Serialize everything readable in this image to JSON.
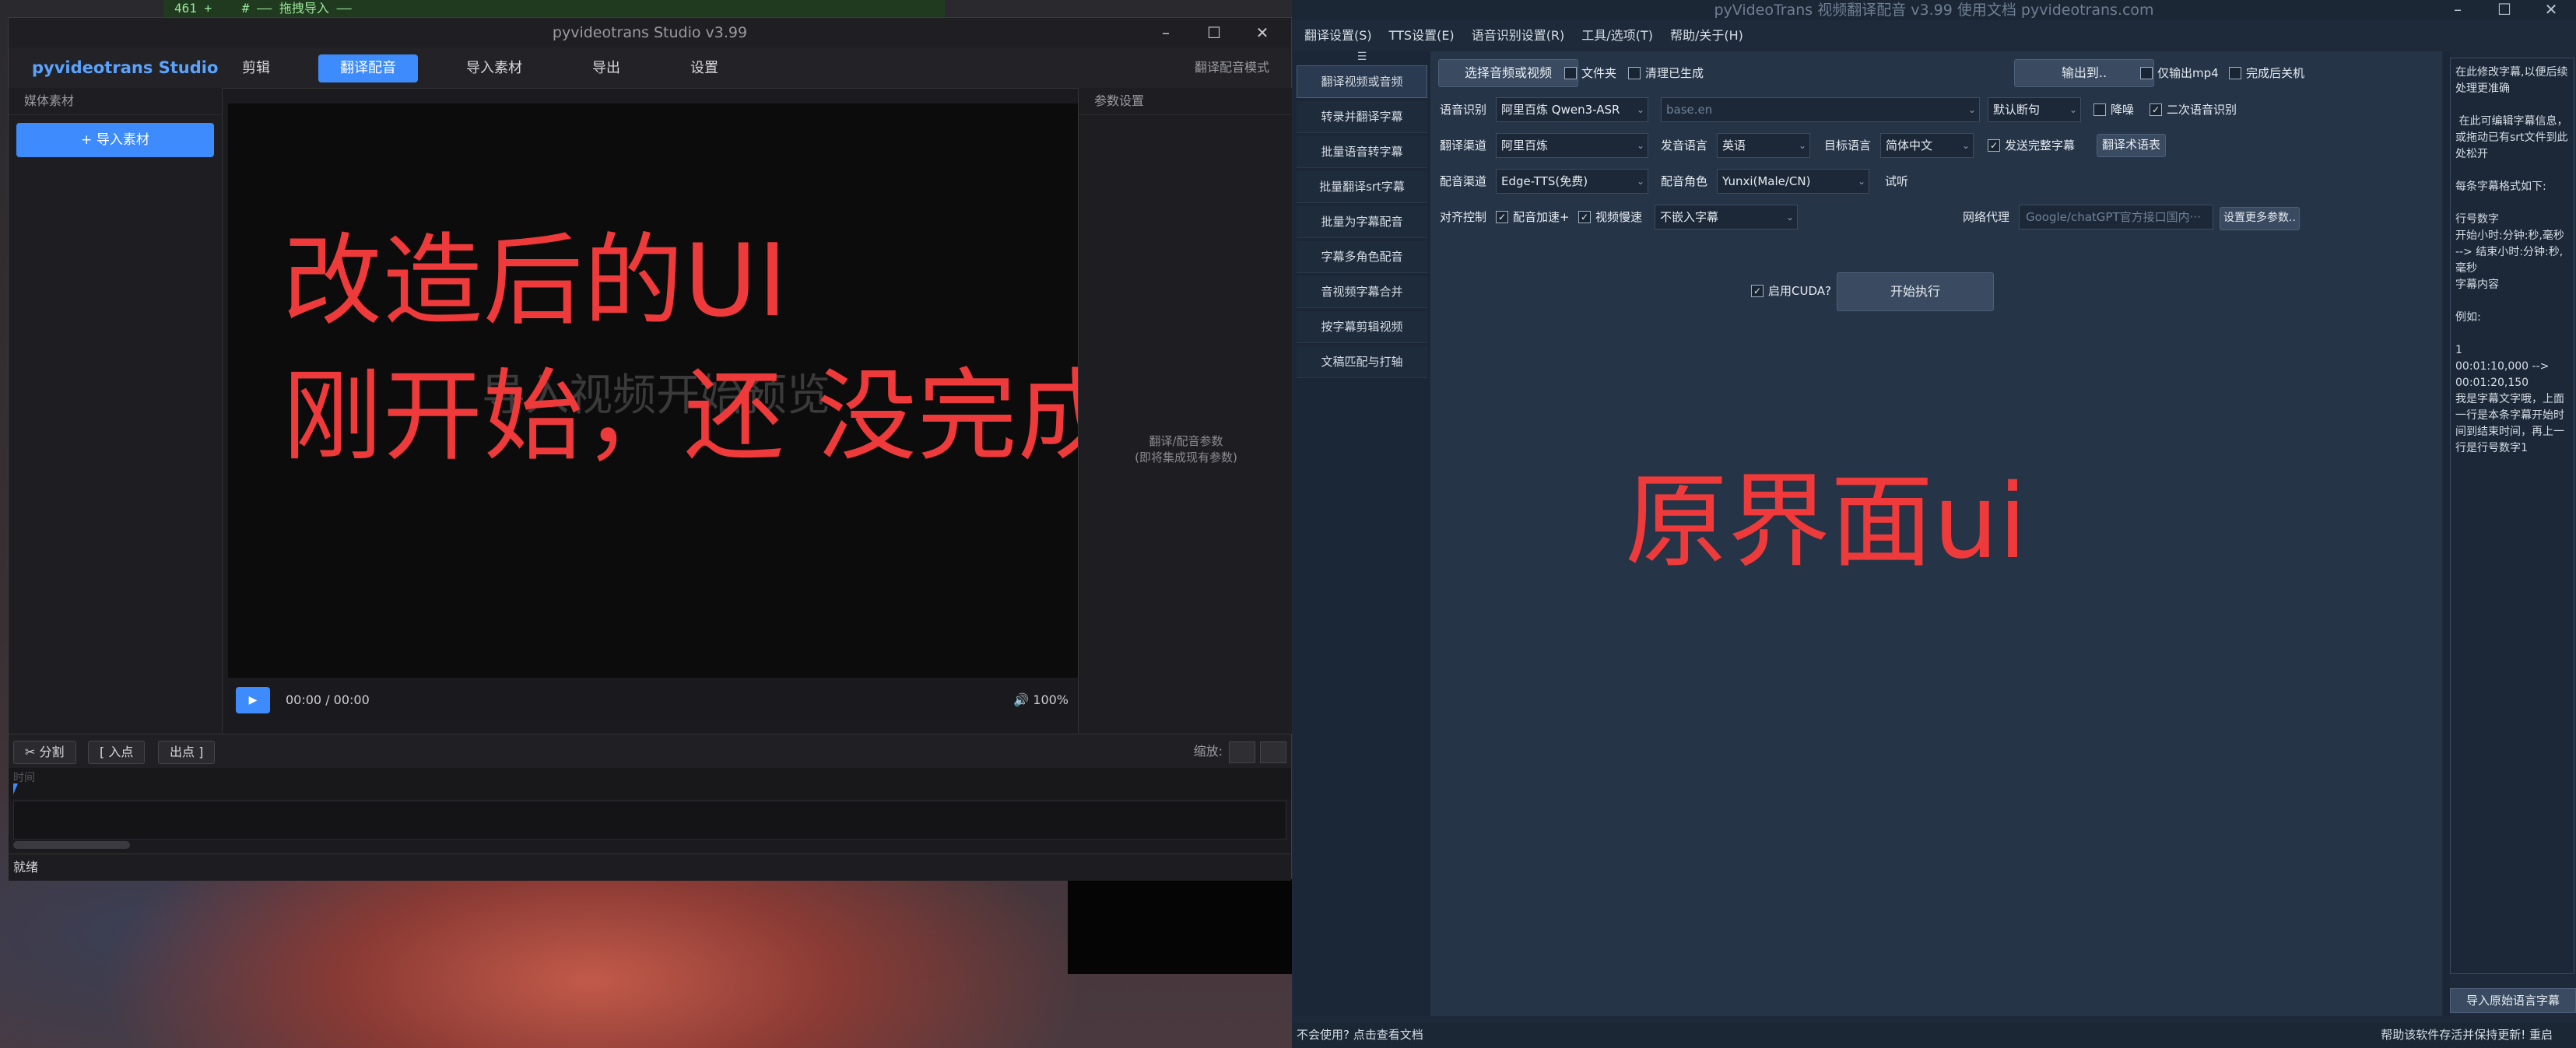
{
  "background": {
    "editor_line": "461 +    # —— 拖拽导入 ——"
  },
  "left_window": {
    "title": "pyvideotrans Studio v3.99",
    "window_controls": [
      "–",
      "☐",
      "✕"
    ],
    "brand": "pyvideotrans Studio",
    "tabs": [
      {
        "label": "剪辑",
        "active": false
      },
      {
        "label": "翻译配音",
        "active": true
      },
      {
        "label": "导入素材",
        "active": false
      },
      {
        "label": "导出",
        "active": false
      },
      {
        "label": "设置",
        "active": false
      }
    ],
    "mode_label": "翻译配音模式",
    "media_panel": {
      "header": "媒体素材",
      "import_button": "+ 导入素材"
    },
    "preview": {
      "hint": "导入视频开始预览",
      "overlay_line1": "改造后的UI",
      "overlay_line2": "刚开始，还 没完成"
    },
    "controls": {
      "play_icon": "▶",
      "timecode": "00:00 / 00:00",
      "volume": "🔊 100%"
    },
    "params_panel": {
      "header": "参数设置",
      "placeholder_line1": "翻译/配音参数",
      "placeholder_line2": "(即将集成现有参数)"
    },
    "timeline": {
      "split": "✂ 分割",
      "in_point": "[ 入点",
      "out_point": "出点 ]",
      "zoom_label": "缩放:",
      "ruler_label": "时间"
    },
    "status": "就绪"
  },
  "right_window": {
    "title": "pyVideoTrans 视频翻译配音 v3.99 使用文档 pyvideotrans.com",
    "window_controls": [
      "–",
      "☐",
      "✕"
    ],
    "menu": [
      "翻译设置(S)",
      "TTS设置(E)",
      "语音识别设置(R)",
      "工具/选项(T)",
      "帮助/关于(H)"
    ],
    "sidebar": [
      {
        "label": "翻译视频或音频",
        "active": true
      },
      {
        "label": "转录并翻译字幕",
        "active": false
      },
      {
        "label": "批量语音转字幕",
        "active": false
      },
      {
        "label": "批量翻译srt字幕",
        "active": false
      },
      {
        "label": "批量为字幕配音",
        "active": false
      },
      {
        "label": "字幕多角色配音",
        "active": false
      },
      {
        "label": "音视频字幕合并",
        "active": false
      },
      {
        "label": "按字幕剪辑视频",
        "active": false
      },
      {
        "label": "文稿匹配与打轴",
        "active": false
      }
    ],
    "form": {
      "select_media": "选择音频或视频",
      "folder_check": "文件夹",
      "clear_check": "清理已生成",
      "output_button": "输出到..",
      "only_mp4": "仅输出mp4",
      "shutdown": "完成后关机",
      "asr_label": "语音识别",
      "asr_value": "阿里百炼 Qwen3-ASR",
      "model_value": "base.en",
      "split_value": "默认断句",
      "denoise": "降噪",
      "second_asr": "二次语音识别",
      "trans_label": "翻译渠道",
      "trans_value": "阿里百炼",
      "src_lang_label": "发音语言",
      "src_lang_value": "英语",
      "tgt_lang_label": "目标语言",
      "tgt_lang_value": "简体中文",
      "send_full": "发送完整字幕",
      "glossary": "翻译术语表",
      "tts_label": "配音渠道",
      "tts_value": "Edge-TTS(免费)",
      "voice_label": "配音角色",
      "voice_value": "Yunxi(Male/CN)",
      "listen": "试听",
      "align_label": "对齐控制",
      "tts_speed": "配音加速+",
      "video_slow": "视频慢速",
      "embed_value": "不嵌入字幕",
      "proxy_label": "网络代理",
      "proxy_placeholder": "Google/chatGPT官方接口国内···",
      "more_params": "设置更多参数..",
      "cuda": "启用CUDA?",
      "start": "开始执行"
    },
    "overlay": "原界面ui",
    "subtitle_text": "在此修改字幕,以便后续处理更准确\n\n 在此可编辑字幕信息，或拖动已有srt文件到此处松开\n\n每条字幕格式如下:\n\n行号数字\n开始小时:分钟:秒,毫秒 --> 结束小时:分钟:秒,毫秒\n字幕内容\n\n例如:\n\n1\n00:01:10,000 --> 00:01:20,150\n我是字幕文字哦，上面一行是本条字幕开始时间到结束时间，再上一行是行号数字1",
    "import_subtitle": "导入原始语言字幕",
    "status_left": "不会使用? 点击查看文档",
    "status_right": "帮助该软件存活并保持更新!  重启"
  }
}
